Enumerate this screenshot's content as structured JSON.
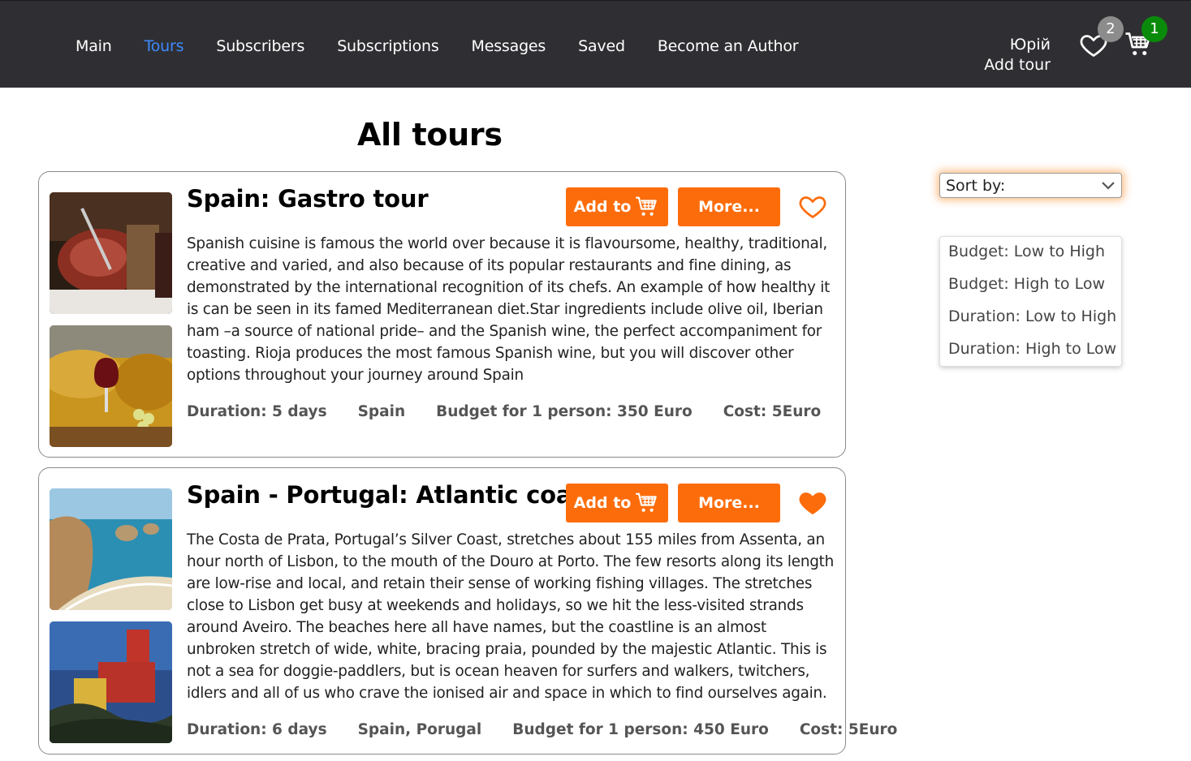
{
  "nav": {
    "links": [
      "Main",
      "Tours",
      "Subscribers",
      "Subscriptions",
      "Messages",
      "Saved",
      "Become an Author"
    ],
    "active_index": 1,
    "user_name": "Юрій",
    "add_tour": "Add tour",
    "favorites_count": "2",
    "cart_count": "1"
  },
  "page": {
    "title": "All tours"
  },
  "tours": [
    {
      "title": "Spain: Gastro tour",
      "add_label": "Add to",
      "more_label": "More...",
      "favorited": false,
      "description": "Spanish cuisine is famous the world over because it is flavoursome, healthy, traditional, creative and varied, and also because of its popular restaurants and fine dining, as demonstrated by the international recognition of its chefs. An example of how healthy it is can be seen in its famed Mediterranean diet.Star ingredients include olive oil, Iberian ham –a source of national pride– and the Spanish wine, the perfect accompaniment for toasting. Rioja produces the most famous Spanish wine, but you will discover other options throughout your journey around Spain",
      "duration": "Duration: 5 days",
      "country": "Spain",
      "budget": "Budget for 1 person: 350 Euro",
      "cost": "Cost: 5Euro"
    },
    {
      "title": "Spain - Portugal: Atlantic coast",
      "add_label": "Add to",
      "more_label": "More...",
      "favorited": true,
      "description": "The Costa de Prata, Portugal’s Silver Coast, stretches about 155 miles from Assenta, an hour north of Lisbon, to the mouth of the Douro at Porto. The few resorts along its length are low-rise and local, and retain their sense of working fishing villages. The stretches close to Lisbon get busy at weekends and holidays, so we hit the less-visited strands around Aveiro. The beaches here all have names, but the coastline is an almost unbroken stretch of wide, white, bracing praia, pounded by the majestic Atlantic. This is not a sea for doggie-paddlers, but is ocean heaven for surfers and walkers, twitchers, idlers and all of us who crave the ionised air and space in which to find ourselves again.",
      "duration": "Duration: 6 days",
      "country": "Spain, Porugal",
      "budget": "Budget for 1 person: 450 Euro",
      "cost": "Cost: 5Euro"
    }
  ],
  "sort": {
    "label": "Sort by:",
    "options": [
      "Budget: Low to High",
      "Budget: High to Low",
      "Duration: Low to High",
      "Duration: High to Low"
    ]
  },
  "colors": {
    "accent": "#fd6c0a",
    "header_bg": "#2f2f33",
    "active_link": "#3d8bfd",
    "badge_green": "#0a8a0a",
    "badge_gray": "#8c8c8c"
  }
}
